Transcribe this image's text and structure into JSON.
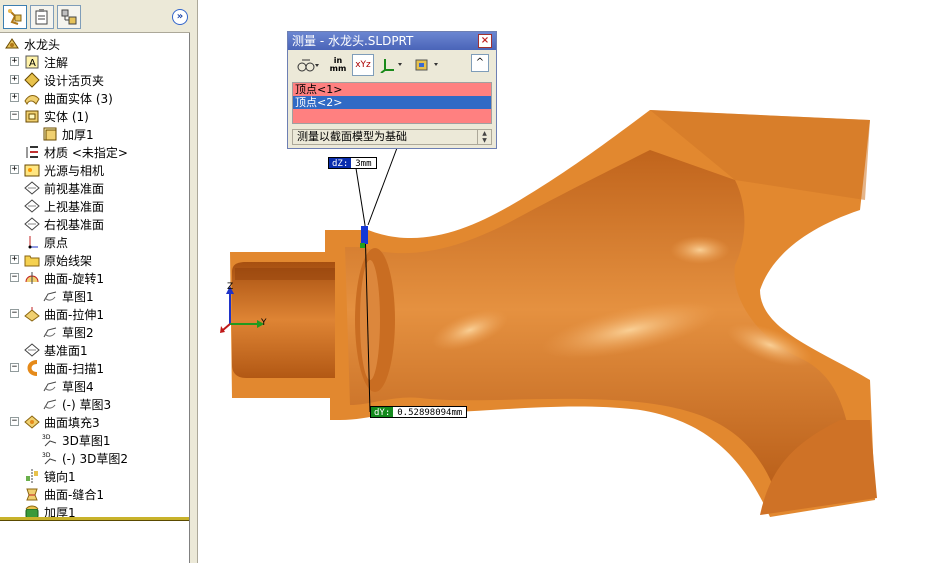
{
  "feature_manager": {
    "tabs": [
      "feature-manager",
      "property-manager",
      "configuration-manager"
    ],
    "collapse_label": "»",
    "tree": [
      {
        "id": "root",
        "label": "水龙头",
        "icon": "part-icon",
        "expander": ""
      },
      {
        "id": "annotations",
        "label": "注解",
        "icon": "annotation-icon",
        "expander": "+"
      },
      {
        "id": "design-binder",
        "label": "设计活页夹",
        "icon": "design-binder-icon",
        "expander": "+"
      },
      {
        "id": "surface-bodies",
        "label": "曲面实体 (3)",
        "icon": "surface-bodies-icon",
        "expander": "+"
      },
      {
        "id": "solid-bodies",
        "label": "实体 (1)",
        "icon": "solid-bodies-icon",
        "expander": "−"
      },
      {
        "id": "thicken-body",
        "label": "加厚1",
        "icon": "solid-body-icon",
        "expander": ""
      },
      {
        "id": "material",
        "label": "材质 <未指定>",
        "icon": "material-icon",
        "expander": ""
      },
      {
        "id": "lights-cameras",
        "label": "光源与相机",
        "icon": "lights-icon",
        "expander": "+"
      },
      {
        "id": "front-plane",
        "label": "前视基准面",
        "icon": "plane-icon",
        "expander": ""
      },
      {
        "id": "top-plane",
        "label": "上视基准面",
        "icon": "plane-icon",
        "expander": ""
      },
      {
        "id": "right-plane",
        "label": "右视基准面",
        "icon": "plane-icon",
        "expander": ""
      },
      {
        "id": "origin",
        "label": "原点",
        "icon": "origin-icon",
        "expander": ""
      },
      {
        "id": "original-wireframe",
        "label": "原始线架",
        "icon": "folder-icon",
        "expander": "+"
      },
      {
        "id": "surface-revolve",
        "label": "曲面-旋转1",
        "icon": "surface-revolve-icon",
        "expander": "−"
      },
      {
        "id": "sketch1",
        "label": "草图1",
        "icon": "sketch-icon",
        "expander": ""
      },
      {
        "id": "surface-extrude",
        "label": "曲面-拉伸1",
        "icon": "surface-extrude-icon",
        "expander": "−"
      },
      {
        "id": "sketch2",
        "label": "草图2",
        "icon": "sketch-icon",
        "expander": ""
      },
      {
        "id": "plane1",
        "label": "基准面1",
        "icon": "plane-icon",
        "expander": ""
      },
      {
        "id": "surface-sweep",
        "label": "曲面-扫描1",
        "icon": "surface-sweep-icon",
        "expander": "−"
      },
      {
        "id": "sketch4",
        "label": "草图4",
        "icon": "sketch-icon",
        "expander": ""
      },
      {
        "id": "sketch3",
        "label": "(-) 草图3",
        "icon": "sketch-icon",
        "expander": ""
      },
      {
        "id": "surface-fill",
        "label": "曲面填充3",
        "icon": "surface-fill-icon",
        "expander": "−"
      },
      {
        "id": "3dsketch1",
        "label": "3D草图1",
        "icon": "3d-sketch-icon",
        "expander": ""
      },
      {
        "id": "3dsketch2",
        "label": "(-) 3D草图2",
        "icon": "3d-sketch-icon",
        "expander": ""
      },
      {
        "id": "mirror",
        "label": "镜向1",
        "icon": "mirror-icon",
        "expander": ""
      },
      {
        "id": "surface-knit",
        "label": "曲面-缝合1",
        "icon": "surface-knit-icon",
        "expander": ""
      },
      {
        "id": "thicken",
        "label": "加厚1",
        "icon": "thicken-icon",
        "expander": ""
      }
    ]
  },
  "measure_dialog": {
    "title": "测量 - 水龙头.SLDPRT",
    "close_label": "×",
    "unit_top": "in",
    "unit_bottom": "mm",
    "xyz_label": "xYz",
    "expand_label": "^",
    "selections": [
      "顶点<1>",
      "顶点<2>"
    ],
    "status": "测量以截面模型为基础"
  },
  "dimensions": {
    "dz_label": "dZ:",
    "dz_value": "3mm",
    "dy_label": "dY:",
    "dy_value": "0.52898094mm"
  },
  "triad": {
    "z": "Z",
    "y": "Y",
    "x": "X"
  },
  "colors": {
    "model_fill": "#d97a2a",
    "model_highlight": "#f2b277",
    "model_shadow": "#a5500f",
    "title_bar": "#5a74c4",
    "selection_bg": "#ff8080",
    "selected_item": "#316ac5"
  }
}
